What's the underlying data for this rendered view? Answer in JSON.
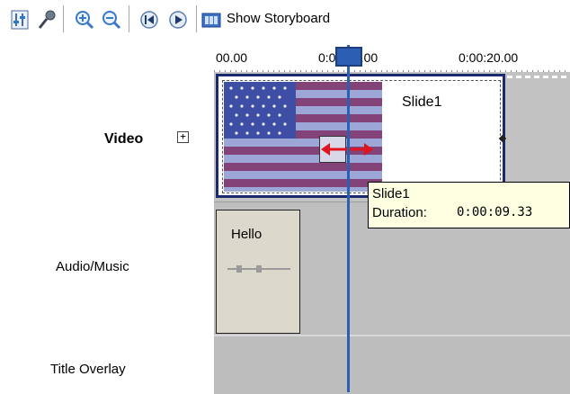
{
  "toolbar": {
    "buttons": [
      {
        "icon": "set-audio-levels-icon"
      },
      {
        "icon": "narrate-timeline-icon"
      },
      {
        "icon": "zoom-in-icon"
      },
      {
        "icon": "zoom-out-icon"
      },
      {
        "icon": "rewind-timeline-icon"
      },
      {
        "icon": "play-timeline-icon"
      }
    ],
    "storyboard_label": "Show Storyboard",
    "storyboard_icon": "storyboard-icon"
  },
  "ruler": {
    "ticks": [
      "00.00",
      "0:00:10.00",
      "0:00:20.00"
    ]
  },
  "tracks": {
    "video_label": "Video",
    "expand_symbol": "+",
    "audio_label": "Audio/Music",
    "overlay_label": "Title Overlay"
  },
  "video_clip": {
    "title": "Slide1"
  },
  "audio_clip": {
    "title": "Hello"
  },
  "tooltip": {
    "name": "Slide1",
    "duration_label": "Duration:",
    "duration_value": "0:00:09.33"
  },
  "colors": {
    "playhead": "#2a5fb4",
    "tooltip_bg": "#ffffe1",
    "trim_arrow": "#e0141e"
  }
}
